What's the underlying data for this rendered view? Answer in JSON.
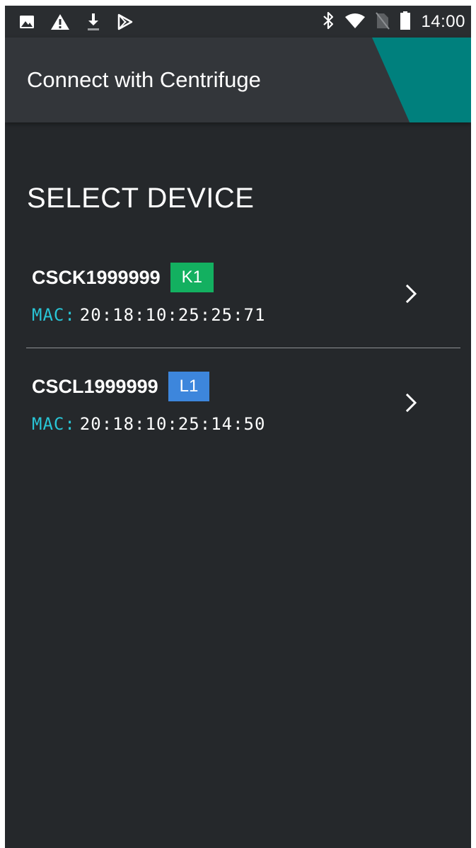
{
  "status_bar": {
    "left_icons": [
      "image-icon",
      "warning-icon",
      "download-icon",
      "play-store-icon"
    ],
    "right_icons": [
      "bluetooth-icon",
      "wifi-icon",
      "no-sim-icon",
      "battery-icon"
    ],
    "time": "14:00"
  },
  "app_bar": {
    "title": "Connect with Centrifuge"
  },
  "colors": {
    "background": "#25282b",
    "app_bar": "#33363a",
    "accent_teal": "#00807d",
    "mac_label": "#29c5d6",
    "badge_k1": "#13b060",
    "badge_l1": "#3d86dc"
  },
  "main": {
    "section_title": "SELECT DEVICE",
    "devices": [
      {
        "name": "CSCK1999999",
        "badge": "K1",
        "badge_color": "#13b060",
        "mac_label": "MAC:",
        "mac": "20:18:10:25:25:71",
        "chevron_icon": "chevron-right-icon"
      },
      {
        "name": "CSCL1999999",
        "badge": "L1",
        "badge_color": "#3d86dc",
        "mac_label": "MAC:",
        "mac": "20:18:10:25:14:50",
        "chevron_icon": "chevron-right-icon"
      }
    ]
  }
}
